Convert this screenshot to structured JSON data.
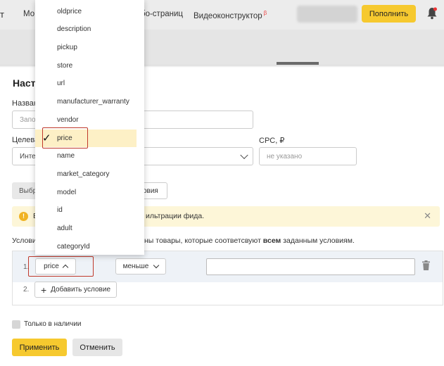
{
  "header": {
    "brand_cut": "т",
    "nav": [
      {
        "label": "Мо"
      },
      {
        "label": "бо-страниц"
      },
      {
        "label": "Видеоконструктор",
        "badge": "β"
      }
    ],
    "topup_label": "Пополнить",
    "icons": {
      "bell": "bell-icon"
    }
  },
  "panel": {
    "title": "Настр",
    "name_label": "Назван",
    "name_placeholder": "Запо",
    "target_label": "Целева",
    "target_value": "Инте",
    "cpc_label": "CPC, ₽",
    "cpc_placeholder": "не указано",
    "select_btn_label": "Выбр",
    "conditions_btn_label": "ловия",
    "notice_text_a": "В",
    "notice_text_b": "ильтрации фида.",
    "conditions_text_a": "Услови",
    "conditions_text_b_pre": "ны товары, которые соответсвуют ",
    "conditions_text_b_bold": "всем",
    "conditions_text_b_post": " заданным условиям.",
    "rows": [
      {
        "number": "1.",
        "field_label": "price",
        "operator_label": "меньше"
      },
      {
        "number": "2.",
        "add_label": "Добавить условие"
      }
    ],
    "in_stock_label": "Только в наличии",
    "apply_label": "Применить",
    "cancel_label": "Отменить"
  },
  "dropdown": {
    "items": [
      "oldprice",
      "description",
      "pickup",
      "store",
      "url",
      "manufacturer_warranty",
      "vendor",
      "price",
      "name",
      "market_category",
      "model",
      "id",
      "adult",
      "categoryId"
    ],
    "selected": "price",
    "check_glyph": "✓"
  },
  "colors": {
    "accent_yellow": "#f6c92f",
    "highlight_red": "#c0392b",
    "notice_bg": "#fdf6d8",
    "selected_bg": "#fdf0c6"
  }
}
